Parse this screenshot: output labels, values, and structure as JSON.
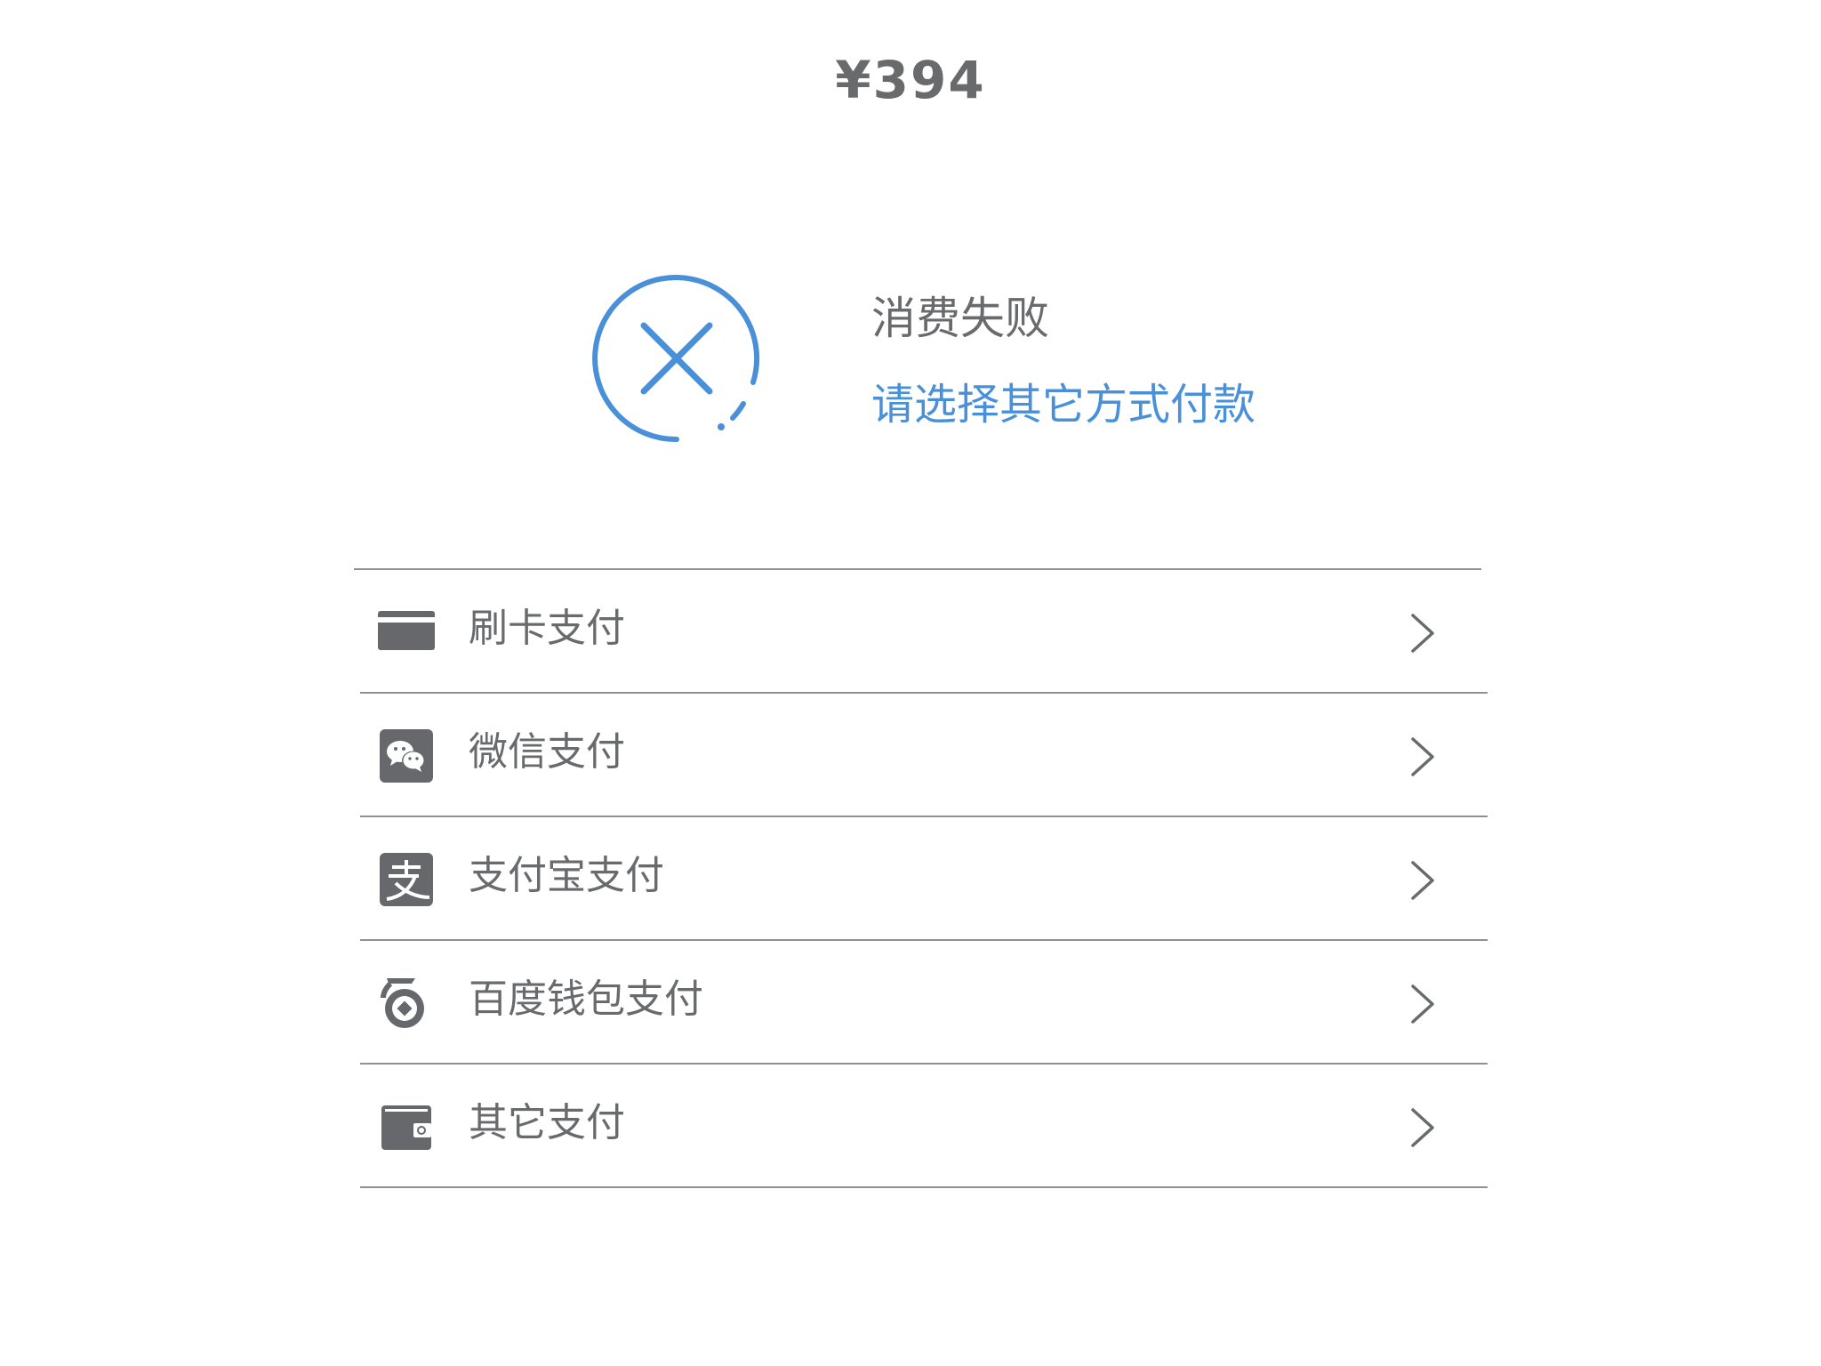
{
  "header": {
    "amount": "¥394"
  },
  "status": {
    "title": "消费失败",
    "subtitle": "请选择其它方式付款",
    "accent_color": "#4a90d9",
    "icon": "failure-circle-x-icon"
  },
  "payment_methods": [
    {
      "label": "刷卡支付",
      "icon": "bank-card-icon"
    },
    {
      "label": "微信支付",
      "icon": "wechat-icon"
    },
    {
      "label": "支付宝支付",
      "icon": "alipay-icon"
    },
    {
      "label": "百度钱包支付",
      "icon": "baidu-wallet-icon"
    },
    {
      "label": "其它支付",
      "icon": "wallet-icon"
    }
  ],
  "colors": {
    "text_gray": "#696a6c",
    "divider": "#8f9093",
    "icon_gray": "#66686b"
  }
}
